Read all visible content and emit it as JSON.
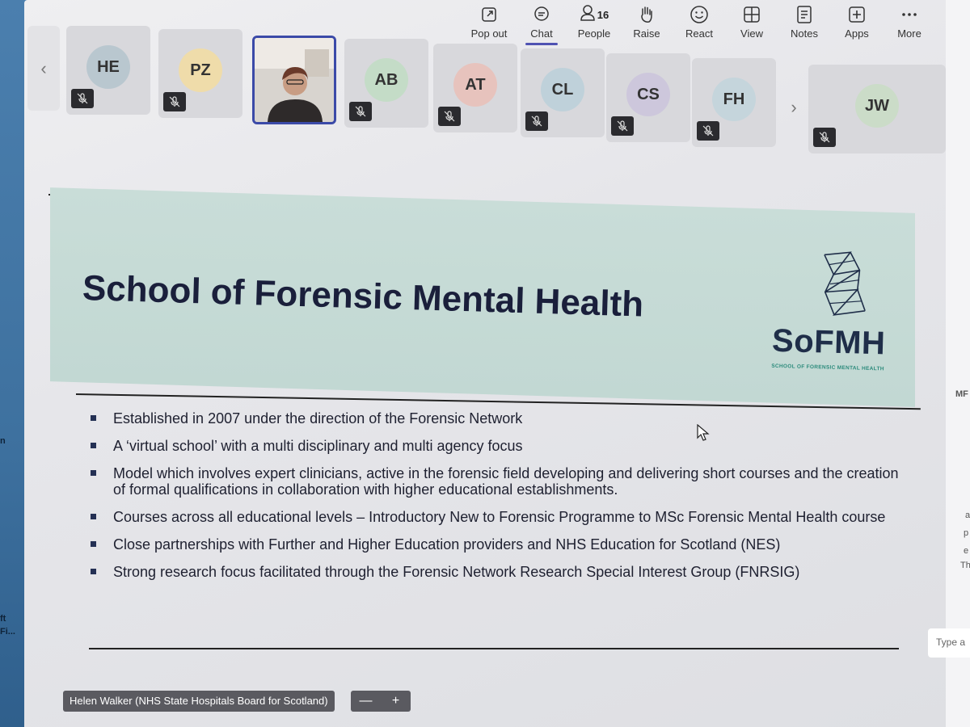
{
  "toolbar": {
    "pop_out": "Pop out",
    "chat": "Chat",
    "people": "People",
    "people_count": "16",
    "raise": "Raise",
    "react": "React",
    "view": "View",
    "notes": "Notes",
    "apps": "Apps",
    "more": "More"
  },
  "participants": [
    {
      "initials": "HE",
      "muted": true,
      "color": "#b9c7cf"
    },
    {
      "initials": "PZ",
      "muted": true,
      "color": "#efdcaa"
    },
    {
      "initials": "",
      "muted": false,
      "video": true
    },
    {
      "initials": "AB",
      "muted": true,
      "color": "#c4dcc7"
    },
    {
      "initials": "AT",
      "muted": true,
      "color": "#e7c3bd"
    },
    {
      "initials": "CL",
      "muted": true,
      "color": "#bfd1da"
    },
    {
      "initials": "CS",
      "muted": true,
      "color": "#cdc7dc"
    },
    {
      "initials": "FH",
      "muted": true,
      "color": "#c5d5dc"
    },
    {
      "initials": "JW",
      "muted": true,
      "color": "#cbdcc8"
    }
  ],
  "slide": {
    "title": "School of Forensic Mental Health",
    "logo_text": "SoFMH",
    "logo_subtext": "SCHOOL OF FORENSIC MENTAL HEALTH",
    "bullets": [
      "Established in 2007 under the direction of the Forensic Network",
      "A ‘virtual school’ with a multi disciplinary and multi agency focus",
      "Model which involves expert clinicians, active in the forensic field developing and delivering short courses and the creation of formal qualifications in collaboration with higher educational establishments.",
      "Courses across all educational levels – Introductory New to Forensic Programme to MSc Forensic Mental Health course",
      "Close partnerships with Further and Higher Education providers and NHS Education for Scotland (NES)",
      "Strong research focus facilitated through the Forensic Network Research Special Interest Group (FNRSIG)"
    ]
  },
  "presenter_name": "Helen Walker (NHS State Hospitals Board for Scotland)",
  "zoom": {
    "minus": "—",
    "plus": "+"
  },
  "chat_placeholder": "Type a",
  "right_pane_snippets": [
    "MF",
    "a",
    "p",
    "e",
    "Th"
  ],
  "left_strip_snippets": [
    "n",
    "ft",
    "Fi..."
  ]
}
